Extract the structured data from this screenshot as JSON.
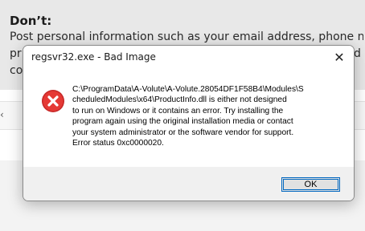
{
  "background": {
    "heading": "Don’t:",
    "line1": "Post personal information such as your email address, phone number,",
    "line2_fragment": "pr",
    "line2_right_fragment": "d",
    "line3_fragment": "co"
  },
  "dialog": {
    "title": "regsvr32.exe - Bad Image",
    "close_glyph": "✕",
    "message_lines": [
      "C:\\ProgramData\\A-Volute\\A-Volute.28054DF1F58B4\\Modules\\S",
      "cheduledModules\\x64\\ProductInfo.dll is either not designed",
      "to run on Windows or it contains an error. Try installing the",
      "program again using the original installation media or contact",
      "your system administrator or the software vendor for support.",
      "Error status 0xc0000020."
    ],
    "ok_label": "OK",
    "icon": "error-icon",
    "colors": {
      "error_red": "#d32f2f",
      "focus_blue": "#0067c0"
    }
  }
}
